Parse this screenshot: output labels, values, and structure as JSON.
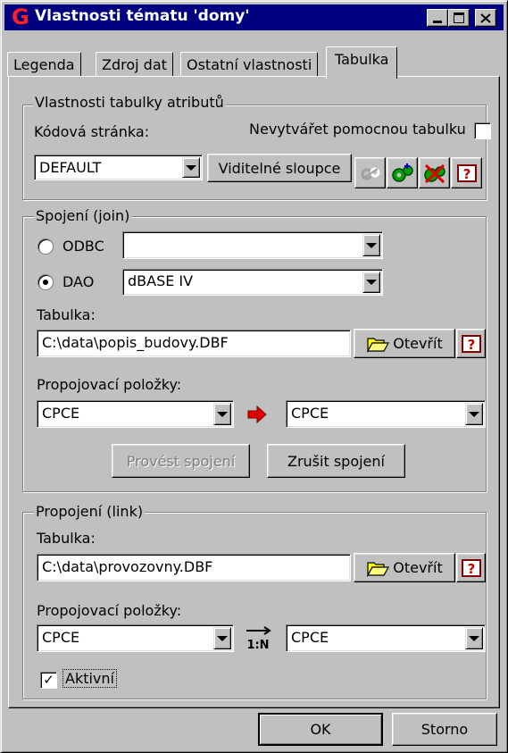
{
  "window": {
    "title": "Vlastnosti tématu 'domy'",
    "app_logo": "G",
    "caption_buttons": [
      "minimize-icon",
      "maximize-icon",
      "close-icon"
    ]
  },
  "tabs": [
    {
      "label": "Legenda",
      "active": false
    },
    {
      "label": "Zdroj dat",
      "active": false
    },
    {
      "label": "Ostatní vlastnosti",
      "active": false
    },
    {
      "label": "Tabulka",
      "active": true
    }
  ],
  "attributes": {
    "legend": "Vlastnosti tabulky atributů",
    "code_page_label": "Kódová stránka:",
    "code_page_value": "DEFAULT",
    "no_aux_table_label": "Nevytvářet pomocnou tabulku",
    "no_aux_table_checked": false,
    "visible_columns_button": "Viditelné sloupce",
    "tool_icons": [
      "disabled-settings-icon",
      "gear-add-icon",
      "gear-delete-icon",
      "help-icon"
    ]
  },
  "join": {
    "legend": "Spojení (join)",
    "odbc_label": "ODBC",
    "odbc_value": "",
    "dao_label": "DAO",
    "dao_value": "dBASE IV",
    "selected_source": "DAO",
    "table_label": "Tabulka:",
    "table_value": "C:\\data\\popis_budovy.DBF",
    "open_button": "Otevřít",
    "fields_label": "Propojovací položky:",
    "left_field": "CPCE",
    "right_field": "CPCE",
    "arrow_icon": "red-arrow-right-icon",
    "execute_button": "Provést spojení",
    "execute_enabled": false,
    "cancel_button": "Zrušit spojení"
  },
  "link": {
    "legend": "Propojení (link)",
    "table_label": "Tabulka:",
    "table_value": "C:\\data\\provozovny.DBF",
    "open_button": "Otevřít",
    "fields_label": "Propojovací položky:",
    "left_field": "CPCE",
    "right_field": "CPCE",
    "relation_icon": "one-to-n-icon",
    "relation_text": "1:N",
    "active_label": "Aktivní",
    "active_checked": true
  },
  "footer": {
    "ok": "OK",
    "cancel": "Storno"
  },
  "colors": {
    "titlebar": "#000080",
    "face": "#c0c0c0",
    "logo": "#ff2020",
    "arrow": "#e00000"
  }
}
